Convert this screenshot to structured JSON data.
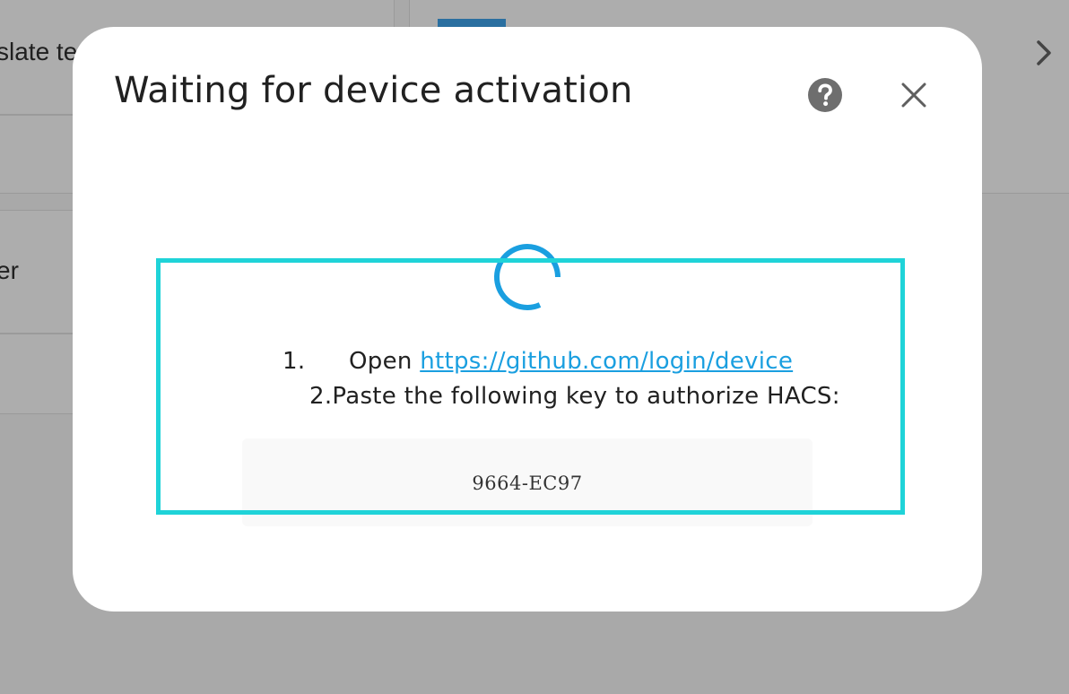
{
  "background": {
    "text_top_left": "slate te",
    "text_mid_left": "er"
  },
  "dialog": {
    "title": "Waiting for device activation",
    "help_icon": "help-circle-icon",
    "close_icon": "close-icon",
    "spinner_color": "#1a9fe0",
    "steps": [
      {
        "number": "1.",
        "prefix": "Open ",
        "link_text": "https://github.com/login/device"
      },
      {
        "text": "2.Paste the following key to authorize HACS:"
      }
    ],
    "device_code": "9664-EC97"
  },
  "colors": {
    "link": "#1a9fe0",
    "highlight": "#1fd3d8",
    "overlay": "#a9a9a9"
  }
}
